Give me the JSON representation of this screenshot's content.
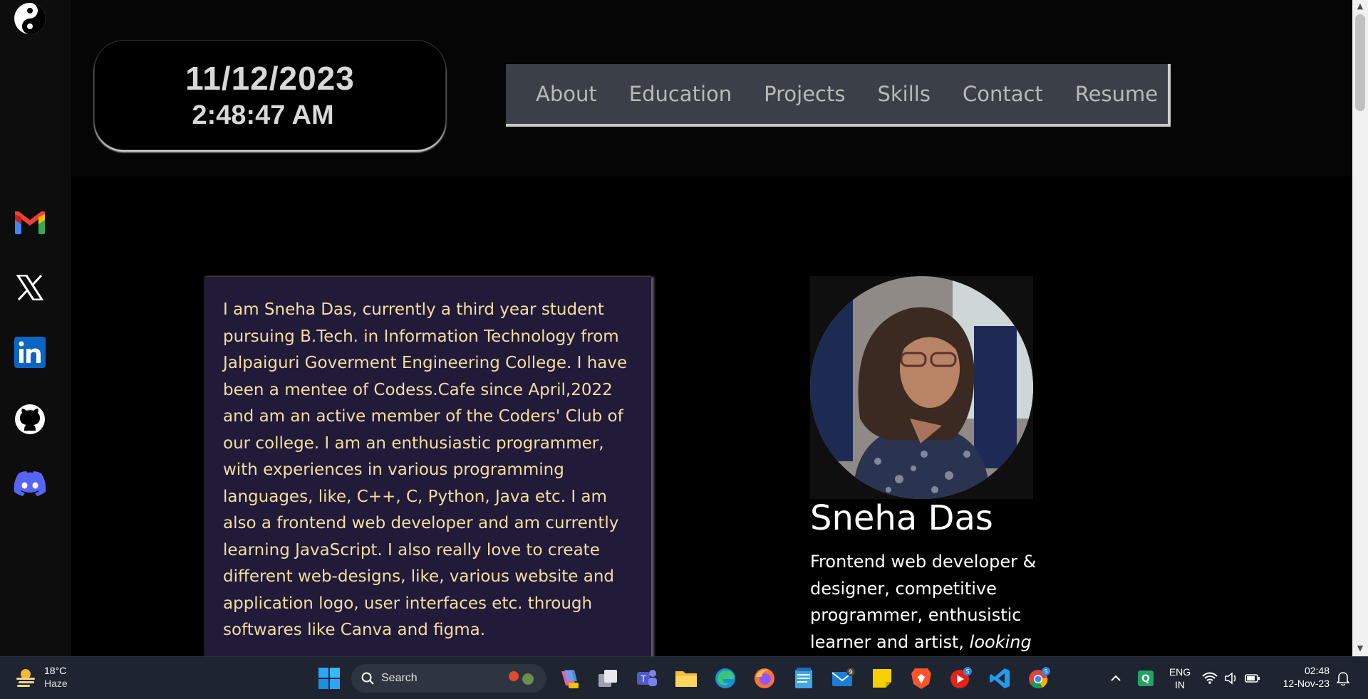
{
  "clock": {
    "date": "11/12/2023",
    "time": "2:48:47 AM"
  },
  "nav": {
    "items": [
      "About",
      "Education",
      "Projects",
      "Skills",
      "Contact",
      "Resume"
    ]
  },
  "sidebar": {
    "icons": [
      "yin-yang-icon",
      "gmail-icon",
      "x-twitter-icon",
      "linkedin-icon",
      "github-icon",
      "discord-icon"
    ]
  },
  "about": {
    "text": "I am Sneha Das, currently a third year student pursuing B.Tech. in Information Technology from Jalpaiguri Goverment Engineering College. I have been a mentee of Codess.Cafe since April,2022 and am an active member of the Coders' Club of our college. I am an enthusiastic programmer, with experiences in various programming languages, like, C++, C, Python, Java etc. I am also a frontend web developer and am currently learning JavaScript. I also really love to create different web-designs, like, various website and application logo, user interfaces etc. through softwares like Canva and figma."
  },
  "profile": {
    "name": "Sneha Das",
    "desc_plain": "Frontend web developer & designer, competitive programmer, enthusistic learner and artist, ",
    "desc_italic": "looking"
  },
  "taskbar": {
    "weather_temp": "18°C",
    "weather_cond": "Haze",
    "search_label": "Search",
    "lang_top": "ENG",
    "lang_bottom": "IN",
    "clock_time": "02:48",
    "clock_date": "12-Nov-23",
    "mail_badge": "9"
  },
  "colors": {
    "card_bg": "#211a38",
    "card_text": "#f4dea0",
    "nav_bg": "#3b3f47",
    "nav_text": "#b9b9b9"
  }
}
